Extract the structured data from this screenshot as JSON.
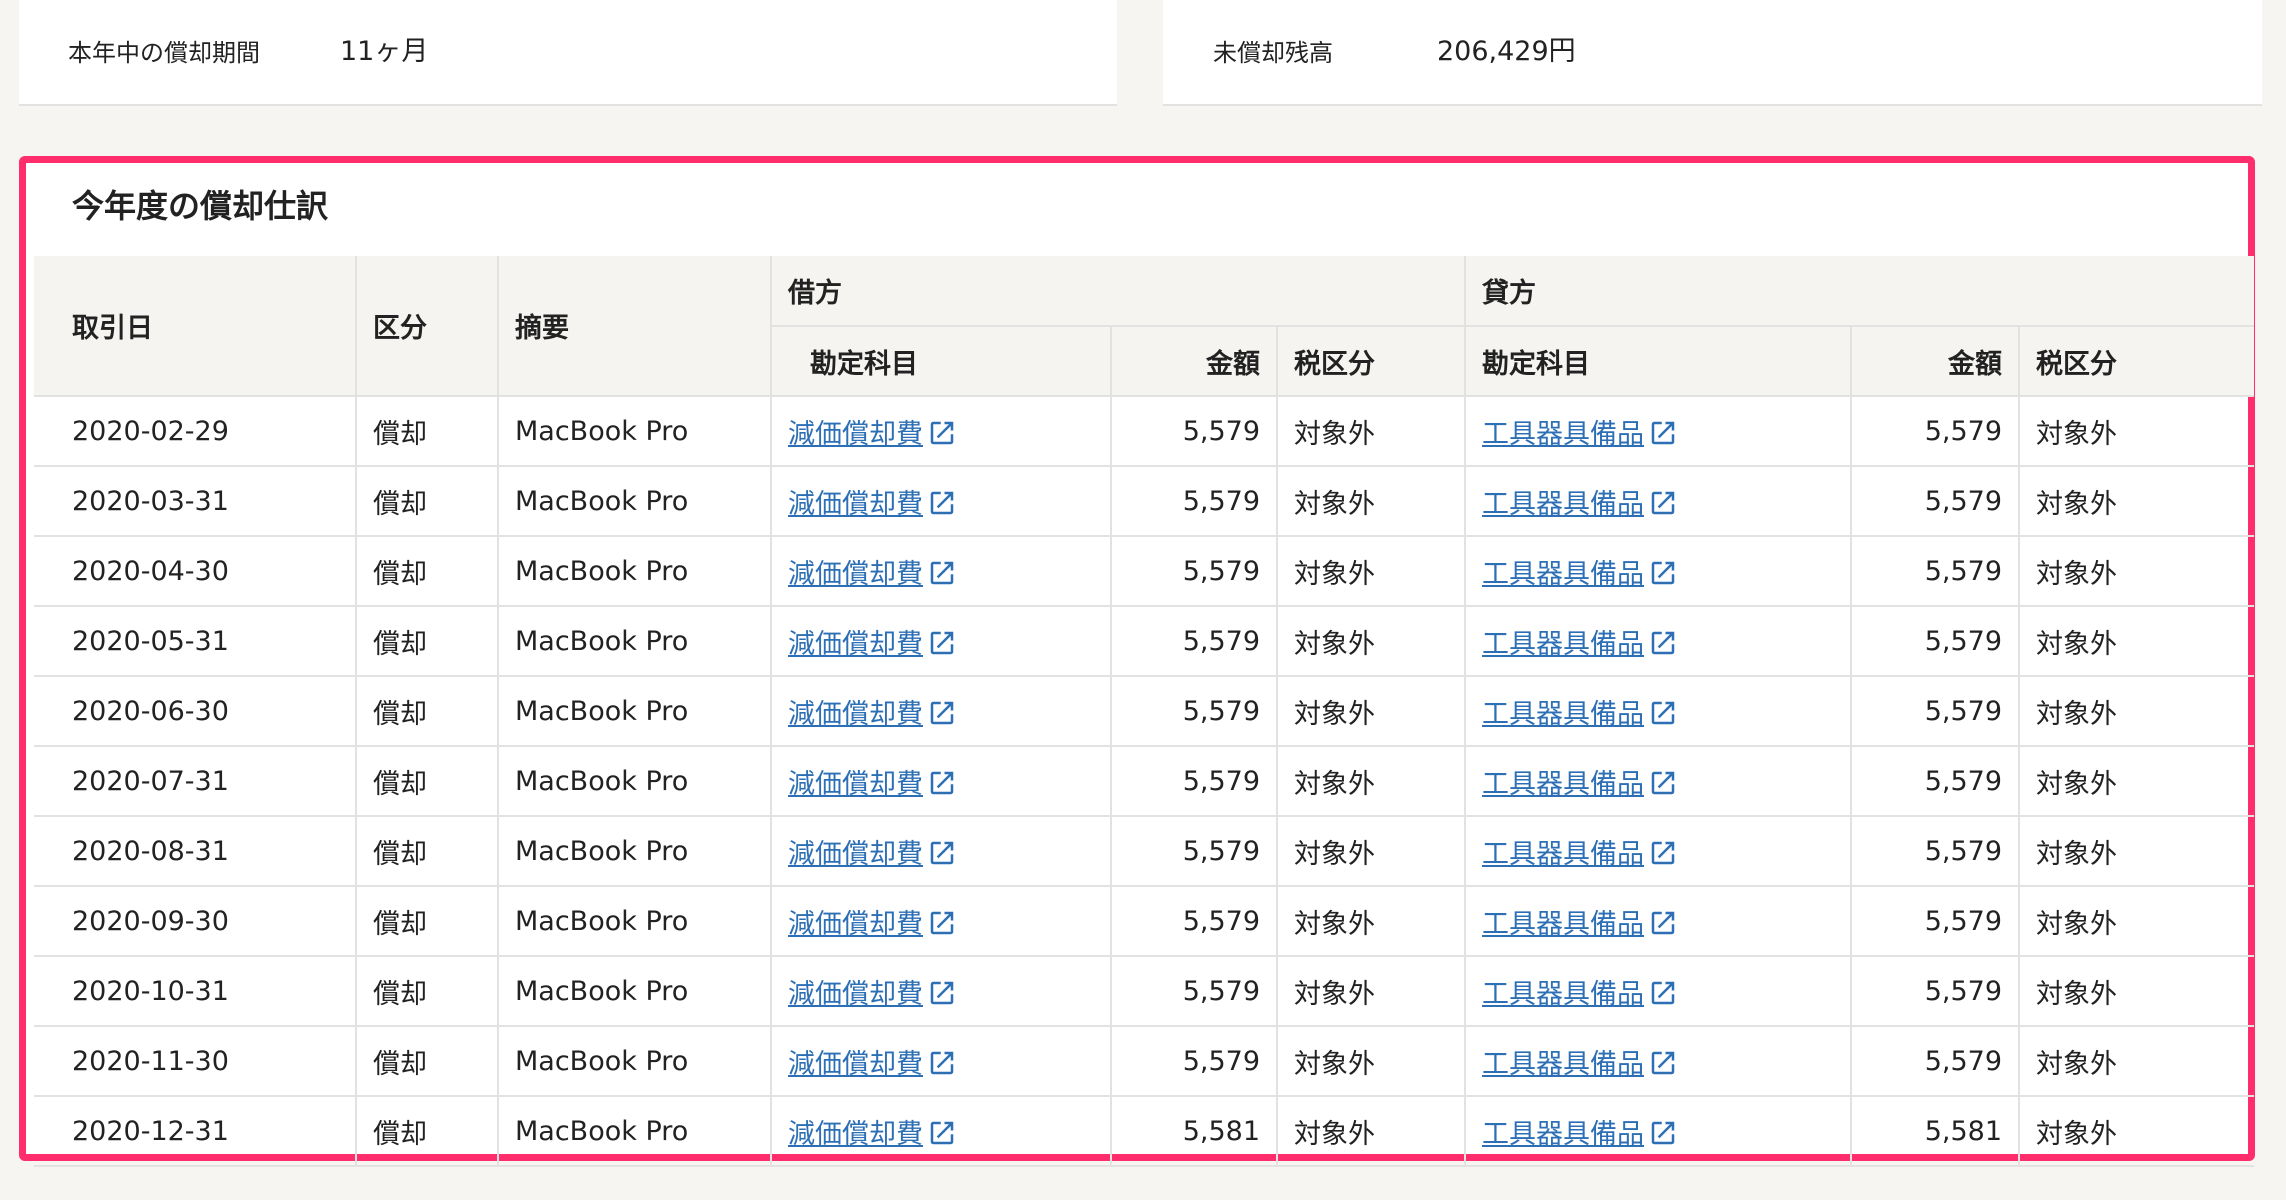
{
  "summary": {
    "period_label": "本年中の償却期間",
    "period_value": "11ヶ月",
    "balance_label": "未償却残高",
    "balance_value": "206,429円"
  },
  "section": {
    "title": "今年度の償却仕訳"
  },
  "table": {
    "headers": {
      "date": "取引日",
      "category": "区分",
      "description": "摘要",
      "debit": "借方",
      "credit": "貸方",
      "debit_account": "勘定科目",
      "debit_amount": "金額",
      "debit_tax": "税区分",
      "credit_account": "勘定科目",
      "credit_amount": "金額",
      "credit_tax": "税区分"
    },
    "rows": [
      {
        "date": "2020-02-29",
        "category": "償却",
        "description": "MacBook Pro",
        "debit_account": "減価償却費",
        "debit_amount": "5,579",
        "debit_tax": "対象外",
        "credit_account": "工具器具備品",
        "credit_amount": "5,579",
        "credit_tax": "対象外"
      },
      {
        "date": "2020-03-31",
        "category": "償却",
        "description": "MacBook Pro",
        "debit_account": "減価償却費",
        "debit_amount": "5,579",
        "debit_tax": "対象外",
        "credit_account": "工具器具備品",
        "credit_amount": "5,579",
        "credit_tax": "対象外"
      },
      {
        "date": "2020-04-30",
        "category": "償却",
        "description": "MacBook Pro",
        "debit_account": "減価償却費",
        "debit_amount": "5,579",
        "debit_tax": "対象外",
        "credit_account": "工具器具備品",
        "credit_amount": "5,579",
        "credit_tax": "対象外"
      },
      {
        "date": "2020-05-31",
        "category": "償却",
        "description": "MacBook Pro",
        "debit_account": "減価償却費",
        "debit_amount": "5,579",
        "debit_tax": "対象外",
        "credit_account": "工具器具備品",
        "credit_amount": "5,579",
        "credit_tax": "対象外"
      },
      {
        "date": "2020-06-30",
        "category": "償却",
        "description": "MacBook Pro",
        "debit_account": "減価償却費",
        "debit_amount": "5,579",
        "debit_tax": "対象外",
        "credit_account": "工具器具備品",
        "credit_amount": "5,579",
        "credit_tax": "対象外"
      },
      {
        "date": "2020-07-31",
        "category": "償却",
        "description": "MacBook Pro",
        "debit_account": "減価償却費",
        "debit_amount": "5,579",
        "debit_tax": "対象外",
        "credit_account": "工具器具備品",
        "credit_amount": "5,579",
        "credit_tax": "対象外"
      },
      {
        "date": "2020-08-31",
        "category": "償却",
        "description": "MacBook Pro",
        "debit_account": "減価償却費",
        "debit_amount": "5,579",
        "debit_tax": "対象外",
        "credit_account": "工具器具備品",
        "credit_amount": "5,579",
        "credit_tax": "対象外"
      },
      {
        "date": "2020-09-30",
        "category": "償却",
        "description": "MacBook Pro",
        "debit_account": "減価償却費",
        "debit_amount": "5,579",
        "debit_tax": "対象外",
        "credit_account": "工具器具備品",
        "credit_amount": "5,579",
        "credit_tax": "対象外"
      },
      {
        "date": "2020-10-31",
        "category": "償却",
        "description": "MacBook Pro",
        "debit_account": "減価償却費",
        "debit_amount": "5,579",
        "debit_tax": "対象外",
        "credit_account": "工具器具備品",
        "credit_amount": "5,579",
        "credit_tax": "対象外"
      },
      {
        "date": "2020-11-30",
        "category": "償却",
        "description": "MacBook Pro",
        "debit_account": "減価償却費",
        "debit_amount": "5,579",
        "debit_tax": "対象外",
        "credit_account": "工具器具備品",
        "credit_amount": "5,579",
        "credit_tax": "対象外"
      },
      {
        "date": "2020-12-31",
        "category": "償却",
        "description": "MacBook Pro",
        "debit_account": "減価償却費",
        "debit_amount": "5,581",
        "debit_tax": "対象外",
        "credit_account": "工具器具備品",
        "credit_amount": "5,581",
        "credit_tax": "対象外"
      }
    ]
  },
  "icons": {
    "account_link": "external-link-icon"
  },
  "colors": {
    "highlight_border": "#ff2d6c",
    "link": "#2d6fb5"
  }
}
